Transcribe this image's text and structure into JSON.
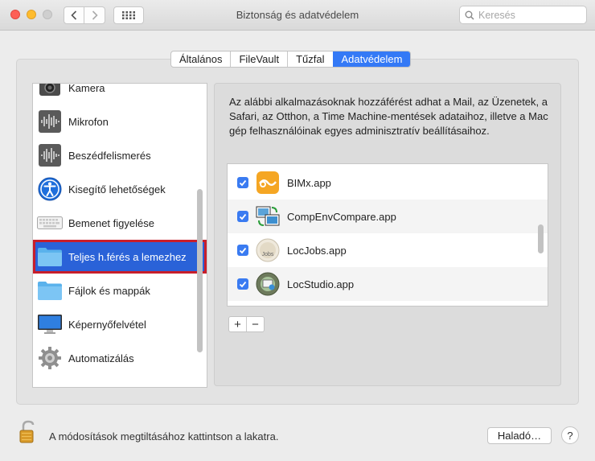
{
  "window": {
    "title": "Biztonság és adatvédelem",
    "search_placeholder": "Keresés"
  },
  "tabs": [
    {
      "label": "Általános",
      "active": false
    },
    {
      "label": "FileVault",
      "active": false
    },
    {
      "label": "Tűzfal",
      "active": false
    },
    {
      "label": "Adatvédelem",
      "active": true
    }
  ],
  "sidebar": {
    "items": [
      {
        "label": "Kamera",
        "icon": "camera-icon"
      },
      {
        "label": "Mikrofon",
        "icon": "microphone-icon"
      },
      {
        "label": "Beszédfelismerés",
        "icon": "speech-recognition-icon"
      },
      {
        "label": "Kisegítő lehetőségek",
        "icon": "accessibility-icon"
      },
      {
        "label": "Bemenet figyelése",
        "icon": "keyboard-icon"
      },
      {
        "label": "Teljes h.férés a lemezhez",
        "icon": "folder-icon",
        "selected": true
      },
      {
        "label": "Fájlok és mappák",
        "icon": "folder-icon"
      },
      {
        "label": "Képernyőfelvétel",
        "icon": "display-icon"
      },
      {
        "label": "Automatizálás",
        "icon": "gear-icon"
      }
    ]
  },
  "description": "Az alábbi alkalmazásoknak hozzáférést adhat a Mail, az Üzenetek, a Safari, az Otthon, a Time Machine-mentések adataihoz, illetve a Mac gép felhasználóinak egyes adminisztratív beállításaihoz.",
  "apps": [
    {
      "name": "BIMx.app",
      "checked": true,
      "icon": "bimx-icon"
    },
    {
      "name": "CompEnvCompare.app",
      "checked": true,
      "icon": "compenvcompare-icon"
    },
    {
      "name": "LocJobs.app",
      "checked": true,
      "icon": "locjobs-icon"
    },
    {
      "name": "LocStudio.app",
      "checked": true,
      "icon": "locstudio-icon"
    }
  ],
  "controls": {
    "add": "+",
    "remove": "−"
  },
  "footer": {
    "lock_text": "A módosítások megtiltásához kattintson a lakatra.",
    "advanced_label": "Haladó…",
    "help_label": "?"
  },
  "colors": {
    "accent": "#3479f6",
    "selection": "#2a62d8",
    "highlight_border": "#c81e2b"
  }
}
